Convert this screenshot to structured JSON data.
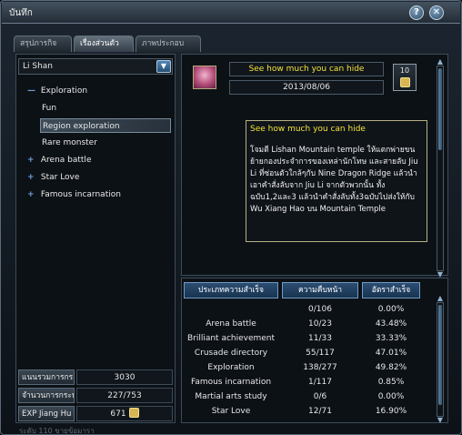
{
  "window": {
    "title": "บันทึก"
  },
  "tabs": [
    {
      "label": "สรุปภารกิจ"
    },
    {
      "label": "เรื่องส่วนตัว"
    },
    {
      "label": "ภาพประกอบ"
    }
  ],
  "left": {
    "character": "Li Shan",
    "tree": [
      {
        "label": "Exploration",
        "marker": "—",
        "level": 0,
        "selected": false
      },
      {
        "label": "Fun",
        "marker": "",
        "level": 1,
        "selected": false
      },
      {
        "label": "Region exploration",
        "marker": "",
        "level": 1,
        "selected": true
      },
      {
        "label": "Rare monster",
        "marker": "",
        "level": 1,
        "selected": false
      },
      {
        "label": "Arena battle",
        "marker": "+",
        "level": 0,
        "selected": false
      },
      {
        "label": "Star Love",
        "marker": "+",
        "level": 0,
        "selected": false
      },
      {
        "label": "Famous incarnation",
        "marker": "+",
        "level": 0,
        "selected": false
      }
    ],
    "stats": [
      {
        "label": "แนนรวมการกระ",
        "value": "3030"
      },
      {
        "label": "จำนวนการกระท",
        "value": "227/753"
      },
      {
        "label": "EXP Jiang Hu",
        "value": "671"
      }
    ],
    "footer_text": "ระดับ 110 ขายข้อมารา"
  },
  "detail": {
    "title": "See how much you can hide",
    "date": "2013/08/06",
    "reward_count": "10",
    "desc_title": "See how much you can hide",
    "desc_body": "โจมตี Lishan Mountain temple ให้แตกพ่ายขนย้ายกองประจำการของเหล่านักโทษ และสายลับ Jiu Li ที่ซ่อนตัวใกล้ๆกับ Nine Dragon Ridge แล้วนำเอาคำสั่งลับจาก Jiu Li จากตัวพวกนั้น ทั้งฉบับ1,2และ3 แล้วนำคำสั่งลับทั้ง3ฉบับไปส่งให้กับ Wu Xiang Hao บน Mountain Temple"
  },
  "table": {
    "headers": [
      "ประเภทความสำเร็จ",
      "ความคืบหน้า",
      "อัตราสำเร็จ"
    ],
    "rows": [
      {
        "category": "",
        "progress": "0/106",
        "rate": "0.00%"
      },
      {
        "category": "Arena battle",
        "progress": "10/23",
        "rate": "43.48%"
      },
      {
        "category": "Brilliant achievement",
        "progress": "11/33",
        "rate": "33.33%"
      },
      {
        "category": "Crusade directory",
        "progress": "55/117",
        "rate": "47.01%"
      },
      {
        "category": "Exploration",
        "progress": "138/277",
        "rate": "49.82%"
      },
      {
        "category": "Famous incarnation",
        "progress": "1/117",
        "rate": "0.85%"
      },
      {
        "category": "Martial arts study",
        "progress": "0/6",
        "rate": "0.00%"
      },
      {
        "category": "Star Love",
        "progress": "12/71",
        "rate": "16.90%"
      }
    ]
  }
}
